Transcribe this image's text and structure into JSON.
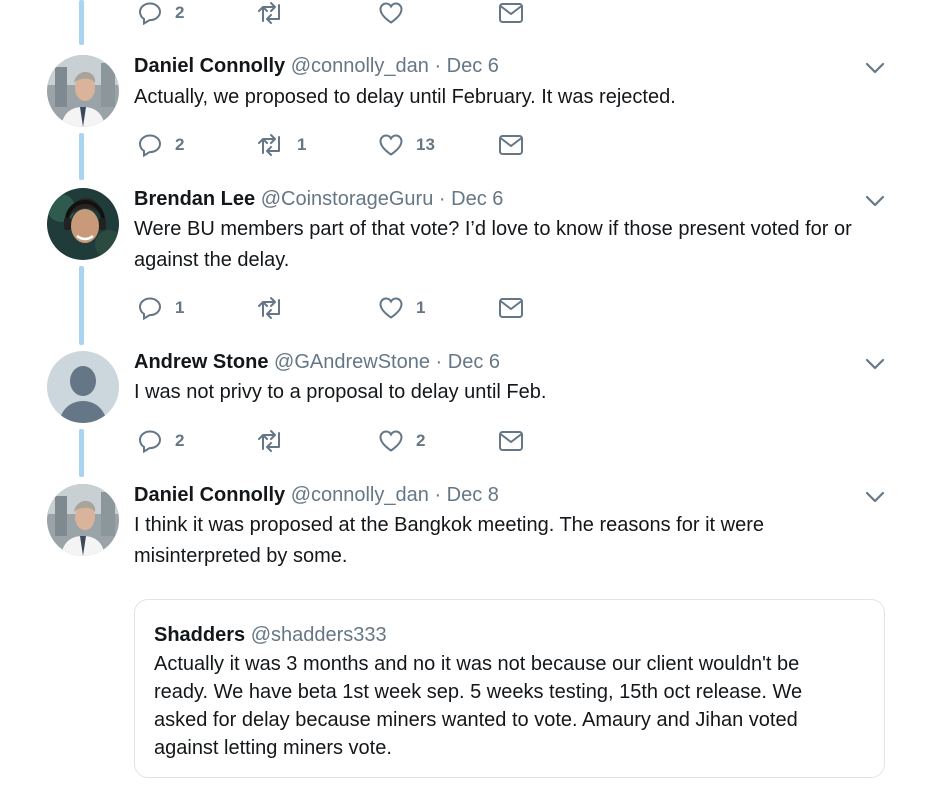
{
  "top_actions": {
    "reply_count": "2",
    "retweet_count": "",
    "like_count": ""
  },
  "tweets": [
    {
      "name": "Daniel Connolly",
      "handle": "@connolly_dan",
      "separator": "·",
      "date": "Dec 6",
      "text": "Actually, we proposed to delay until February. It was rejected.",
      "reply_count": "2",
      "retweet_count": "1",
      "like_count": "13"
    },
    {
      "name": "Brendan Lee",
      "handle": "@CoinstorageGuru",
      "separator": "·",
      "date": "Dec 6",
      "text": "Were BU members part of that vote? I’d love to know if those present voted for or against the delay.",
      "reply_count": "1",
      "retweet_count": "",
      "like_count": "1"
    },
    {
      "name": "Andrew Stone",
      "handle": "@GAndrewStone",
      "separator": "·",
      "date": "Dec 6",
      "text": "I was not privy to a proposal to delay until Feb.",
      "reply_count": "2",
      "retweet_count": "",
      "like_count": "2"
    },
    {
      "name": "Daniel Connolly",
      "handle": "@connolly_dan",
      "separator": "·",
      "date": "Dec 8",
      "text": "I think it was proposed at the Bangkok meeting. The reasons for it were misinterpreted by some."
    }
  ],
  "quoted_tweet": {
    "name": "Shadders",
    "handle": "@shadders333",
    "text": "Actually it was 3 months and no it was not because our client wouldn't be ready.  We have beta 1st week sep.  5 weeks testing, 15th oct release.  We asked for delay because miners wanted to vote.  Amaury and Jihan voted against letting miners vote."
  },
  "colors": {
    "thread_line": "#a8d4f2",
    "secondary_text": "#657786",
    "icon": "#657786"
  },
  "icons": [
    "reply-icon",
    "retweet-icon",
    "like-icon",
    "direct-message-icon",
    "chevron-down-icon"
  ]
}
